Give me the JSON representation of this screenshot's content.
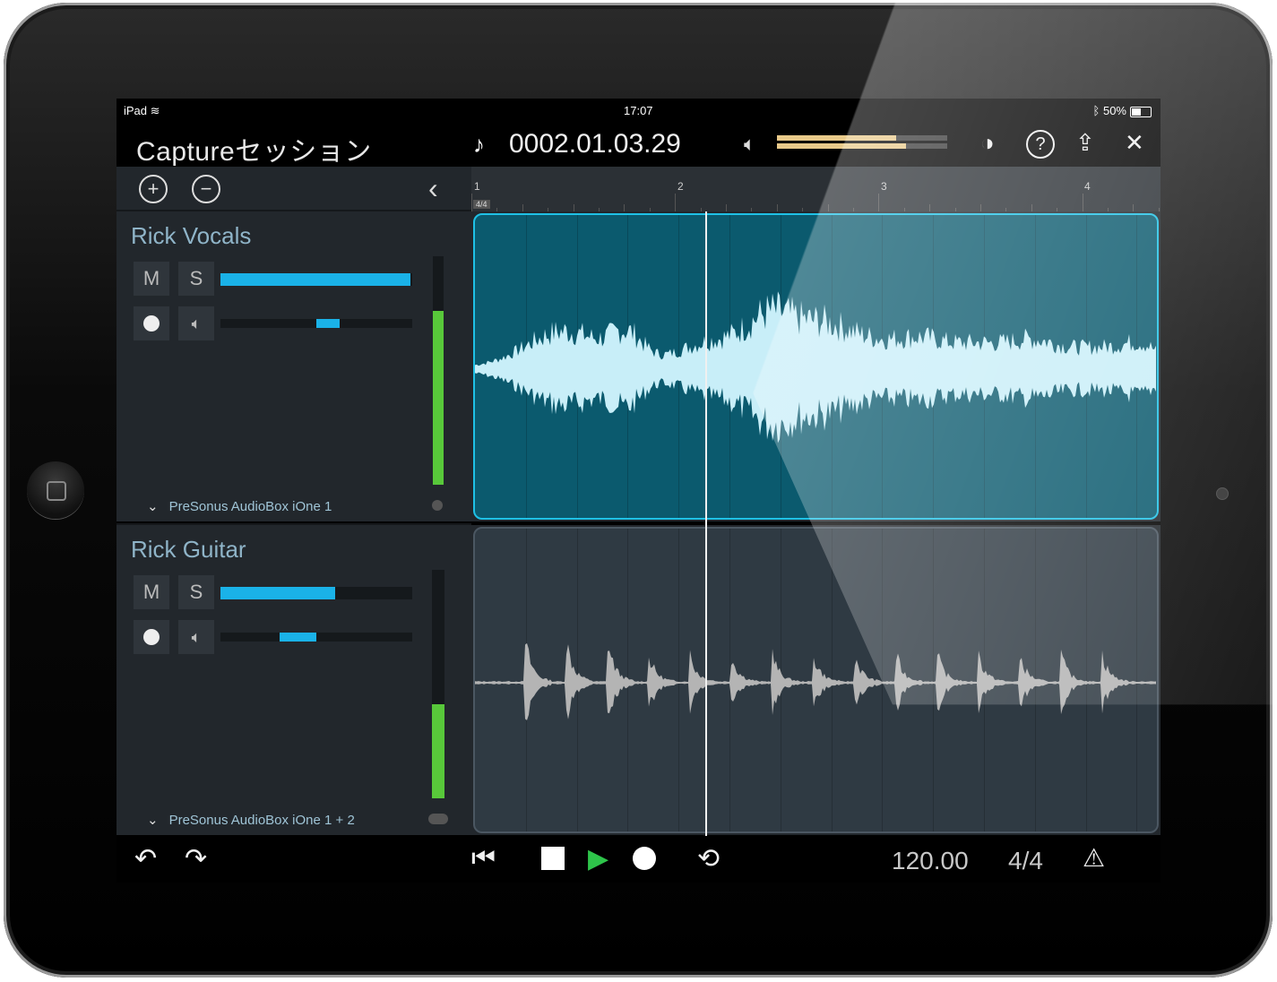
{
  "status": {
    "device": "iPad",
    "time": "17:07",
    "battery": "50%"
  },
  "header": {
    "title": "Captureセッション",
    "position": "0002.01.03.29"
  },
  "levels": {
    "master_left": 0.7,
    "master_right": 0.76
  },
  "ruler": {
    "bars": [
      "1",
      "2",
      "3",
      "4"
    ],
    "signature": "4/4"
  },
  "tracks": [
    {
      "name": "Rick Vocals",
      "mute_label": "M",
      "solo_label": "S",
      "volume": 0.99,
      "pan_start": 0.5,
      "pan_end": 0.62,
      "meter": 0.76,
      "input": "PreSonus AudioBox iOne 1"
    },
    {
      "name": "Rick Guitar",
      "mute_label": "M",
      "solo_label": "S",
      "volume": 0.6,
      "pan_start": 0.31,
      "pan_end": 0.5,
      "meter": 0.41,
      "input": "PreSonus AudioBox iOne 1 + 2"
    }
  ],
  "transport": {
    "tempo": "120.00",
    "time_signature": "4/4"
  },
  "colors": {
    "accent": "#1ab2e8",
    "meter": "#58c83a",
    "clip_vocals": "#0b5a6e",
    "clip_guitar": "#2f3a43"
  }
}
